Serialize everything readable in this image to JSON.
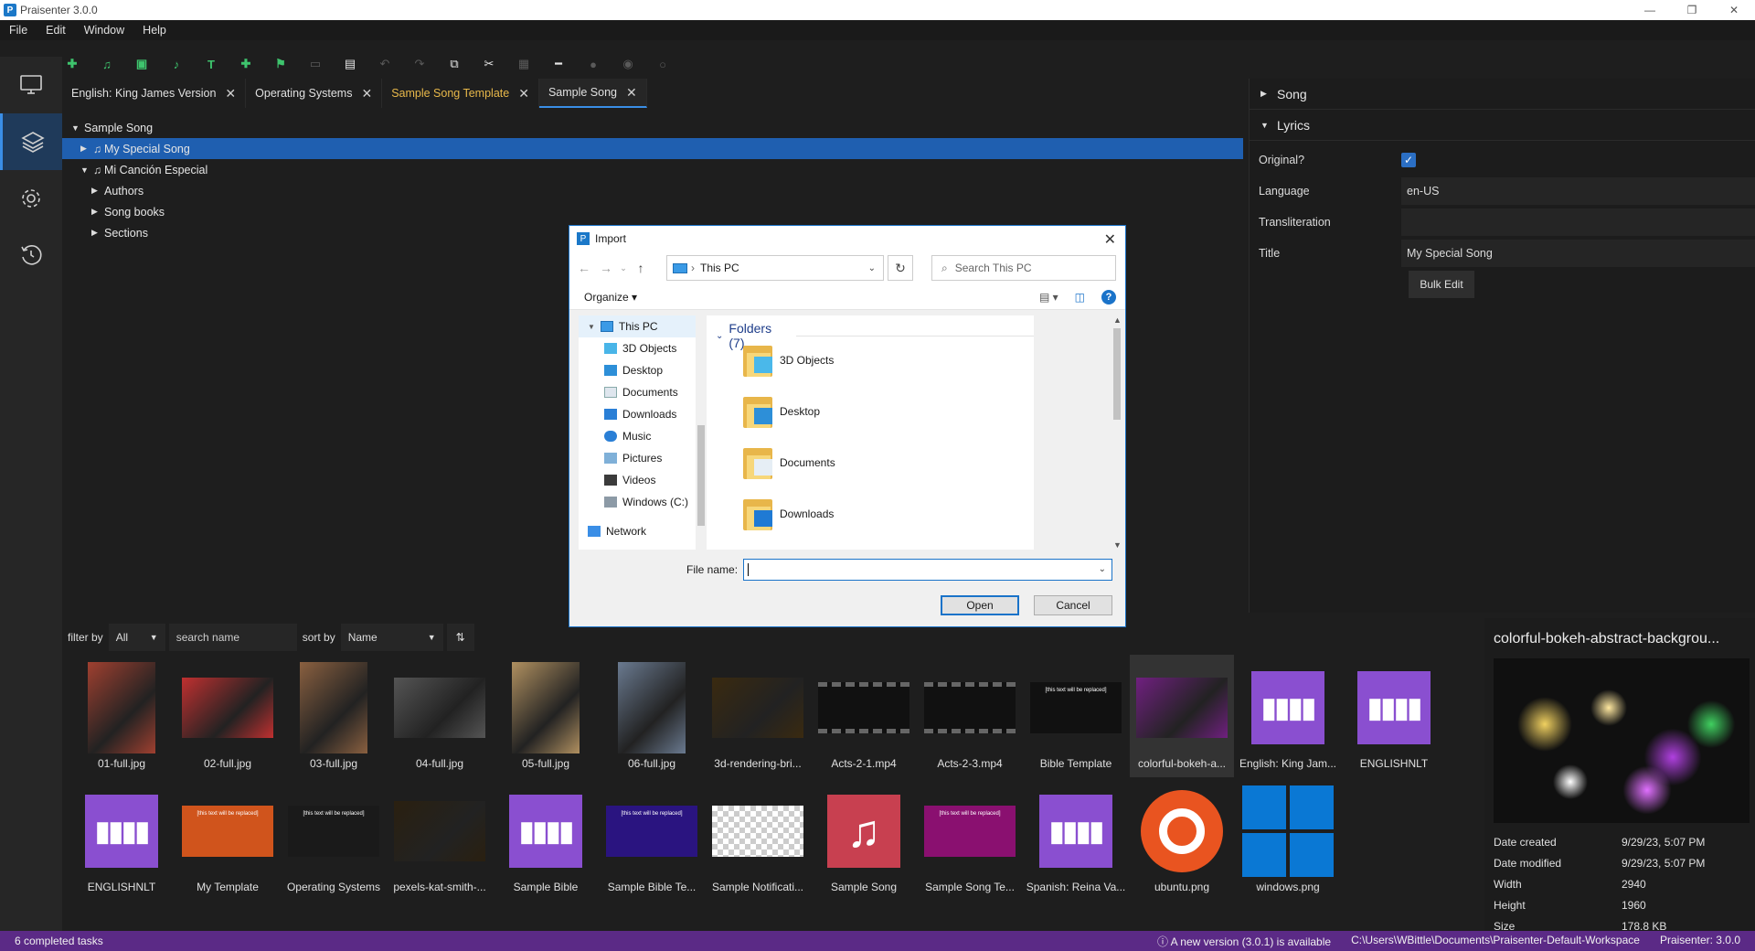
{
  "window": {
    "title": "Praisenter 3.0.0",
    "minimize": "—",
    "restore": "❐",
    "close": "✕"
  },
  "menu": [
    "File",
    "Edit",
    "Window",
    "Help"
  ],
  "rail": [
    "presentation",
    "library",
    "settings",
    "history"
  ],
  "tabs": [
    {
      "label": "English: King James Version"
    },
    {
      "label": "Operating Systems"
    },
    {
      "label": "Sample Song Template"
    },
    {
      "label": "Sample Song"
    }
  ],
  "tree": [
    {
      "label": "Sample Song",
      "expanded": true
    },
    {
      "label": "My Special Song",
      "selected": true
    },
    {
      "label": "Mi Canción Especial",
      "expanded": true
    },
    {
      "label": "Authors"
    },
    {
      "label": "Song books"
    },
    {
      "label": "Sections"
    }
  ],
  "props": {
    "song_header": "Song",
    "lyrics_header": "Lyrics",
    "original_label": "Original?",
    "original_checked": true,
    "language_label": "Language",
    "language_value": "en-US",
    "transliteration_label": "Transliteration",
    "transliteration_value": "",
    "title_label": "Title",
    "title_value": "My Special Song",
    "bulk_edit": "Bulk Edit"
  },
  "filter": {
    "filter_by_label": "filter by",
    "filter_value": "All",
    "search_placeholder": "search name",
    "sort_by_label": "sort by",
    "sort_value": "Name"
  },
  "media": [
    {
      "name": "01-full.jpg",
      "kind": "photo",
      "color": "#a04030"
    },
    {
      "name": "02-full.jpg",
      "kind": "photo",
      "color": "#c03030"
    },
    {
      "name": "03-full.jpg",
      "kind": "photo",
      "color": "#8a6040"
    },
    {
      "name": "04-full.jpg",
      "kind": "photo",
      "color": "#555555"
    },
    {
      "name": "05-full.jpg",
      "kind": "photo",
      "color": "#b09060"
    },
    {
      "name": "06-full.jpg",
      "kind": "photo",
      "color": "#6a7a90"
    },
    {
      "name": "3d-rendering-bri...",
      "kind": "photo",
      "color": "#3a2a10"
    },
    {
      "name": "Acts-2-1.mp4",
      "kind": "video",
      "color": "#111111"
    },
    {
      "name": "Acts-2-3.mp4",
      "kind": "video",
      "color": "#111111"
    },
    {
      "name": "Bible Template",
      "kind": "template",
      "color": "#111111"
    },
    {
      "name": "colorful-bokeh-a...",
      "kind": "photo",
      "color": "#702080",
      "selected": true
    },
    {
      "name": "English: King Jam...",
      "kind": "bible",
      "color": "#8a4fd0"
    },
    {
      "name": "ENGLISHNLT",
      "kind": "bible",
      "color": "#8a4fd0"
    },
    {
      "name": "ENGLISHNLT",
      "kind": "bible",
      "color": "#8a4fd0"
    },
    {
      "name": "My Template",
      "kind": "template",
      "color": "#d0541c"
    },
    {
      "name": "Operating Systems",
      "kind": "template",
      "color": "#1a1a1a"
    },
    {
      "name": "pexels-kat-smith-...",
      "kind": "photo",
      "color": "#2a2010"
    },
    {
      "name": "Sample Bible",
      "kind": "bible",
      "color": "#8a4fd0"
    },
    {
      "name": "Sample Bible Te...",
      "kind": "template",
      "color": "#2a1480"
    },
    {
      "name": "Sample Notificati...",
      "kind": "checker",
      "color": "#cccccc"
    },
    {
      "name": "Sample Song",
      "kind": "song",
      "color": "#c84050"
    },
    {
      "name": "Sample Song Te...",
      "kind": "template",
      "color": "#8a1070"
    },
    {
      "name": "Spanish: Reina Va...",
      "kind": "bible",
      "color": "#8a4fd0"
    },
    {
      "name": "ubuntu.png",
      "kind": "ubuntu",
      "color": "#e95420"
    },
    {
      "name": "windows.png",
      "kind": "windows",
      "color": "#0a78d4"
    }
  ],
  "template_text": "[this text will be replaced]",
  "preview": {
    "title": "colorful-bokeh-abstract-backgrou...",
    "rows": [
      {
        "k": "Date created",
        "v": "9/29/23, 5:07 PM"
      },
      {
        "k": "Date modified",
        "v": "9/29/23, 5:07 PM"
      },
      {
        "k": "Width",
        "v": "2940"
      },
      {
        "k": "Height",
        "v": "1960"
      },
      {
        "k": "Size",
        "v": "178.8 KB"
      }
    ]
  },
  "status": {
    "left": "6 completed tasks",
    "update": "A new version (3.0.1) is available",
    "path": "C:\\Users\\WBittle\\Documents\\Praisenter-Default-Workspace",
    "version": "Praisenter: 3.0.0"
  },
  "dialog": {
    "title": "Import",
    "address": "This PC",
    "search_placeholder": "Search This PC",
    "organize": "Organize ▾",
    "nav": [
      {
        "label": "This PC",
        "icon": "pc",
        "root": true
      },
      {
        "label": "3D Objects",
        "icon": "cube"
      },
      {
        "label": "Desktop",
        "icon": "desktop"
      },
      {
        "label": "Documents",
        "icon": "docs"
      },
      {
        "label": "Downloads",
        "icon": "download"
      },
      {
        "label": "Music",
        "icon": "music"
      },
      {
        "label": "Pictures",
        "icon": "pictures"
      },
      {
        "label": "Videos",
        "icon": "videos"
      },
      {
        "label": "Windows (C:)",
        "icon": "drive"
      },
      {
        "label": "Network",
        "icon": "network",
        "net": true
      }
    ],
    "group_header": "Folders (7)",
    "folders": [
      "3D Objects",
      "Desktop",
      "Documents",
      "Downloads"
    ],
    "file_name_label": "File name:",
    "file_name_value": "",
    "open": "Open",
    "cancel": "Cancel"
  }
}
